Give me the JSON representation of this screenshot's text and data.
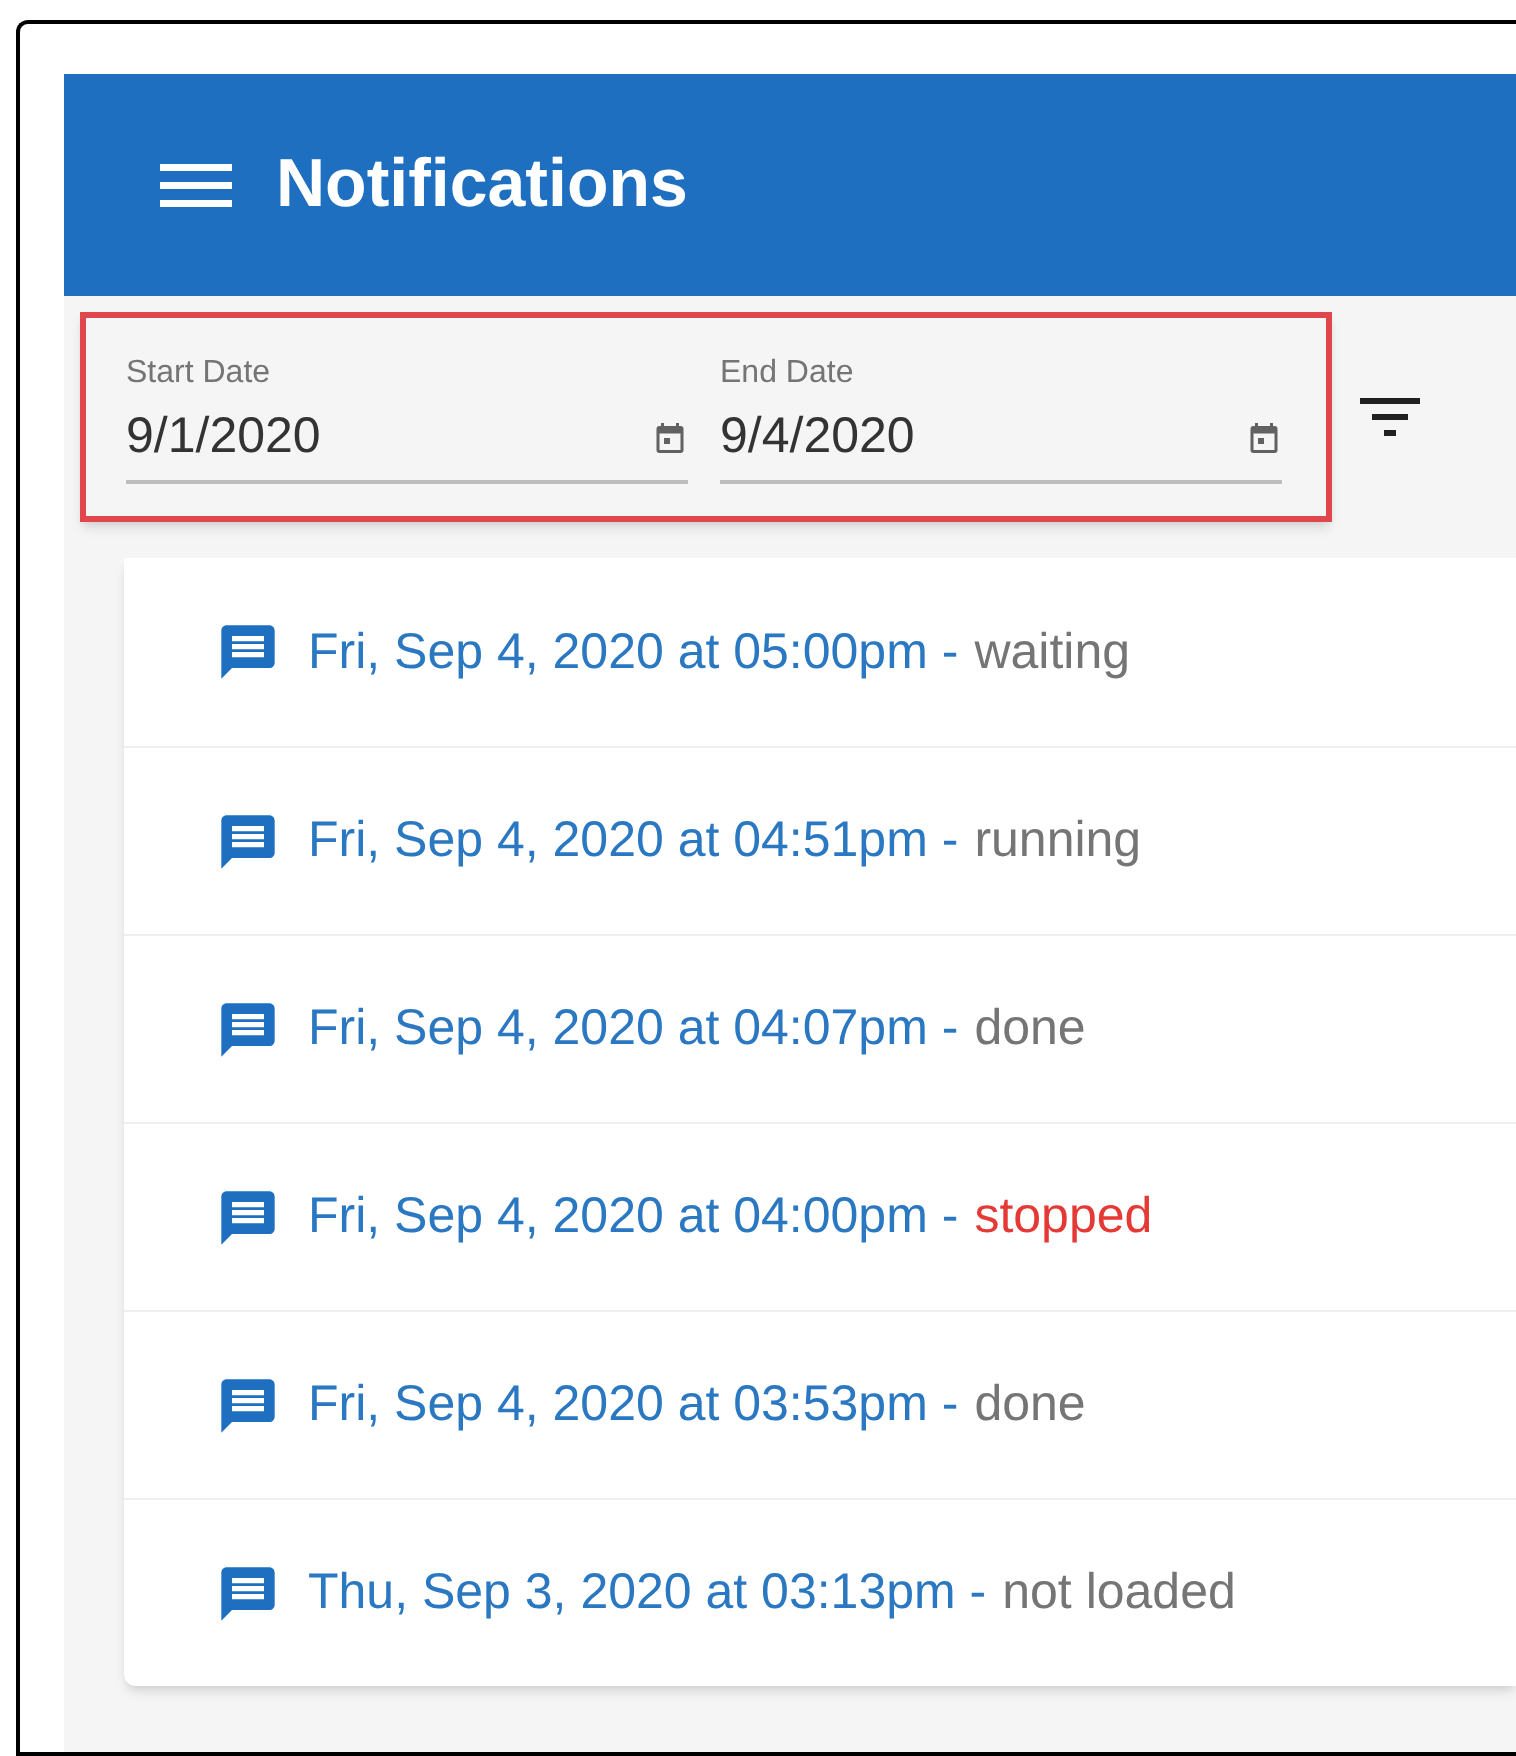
{
  "app_bar": {
    "title": "Notifications"
  },
  "filters": {
    "highlighted": true,
    "fields": [
      {
        "label": "Start Date",
        "value": "9/1/2020"
      },
      {
        "label": "End Date",
        "value": "9/4/2020"
      }
    ]
  },
  "notifications": [
    {
      "date": "Fri, Sep 4, 2020 at 05:00pm -",
      "status": "waiting",
      "color": "#757575"
    },
    {
      "date": "Fri, Sep 4, 2020 at 04:51pm -",
      "status": "running",
      "color": "#757575"
    },
    {
      "date": "Fri, Sep 4, 2020 at 04:07pm -",
      "status": "done",
      "color": "#757575"
    },
    {
      "date": "Fri, Sep 4, 2020 at 04:00pm -",
      "status": "stopped",
      "color": "#e53935"
    },
    {
      "date": "Fri, Sep 4, 2020 at 03:53pm -",
      "status": "done",
      "color": "#757575"
    },
    {
      "date": "Thu, Sep 3, 2020 at 03:13pm -",
      "status": "not loaded",
      "color": "#757575"
    }
  ]
}
